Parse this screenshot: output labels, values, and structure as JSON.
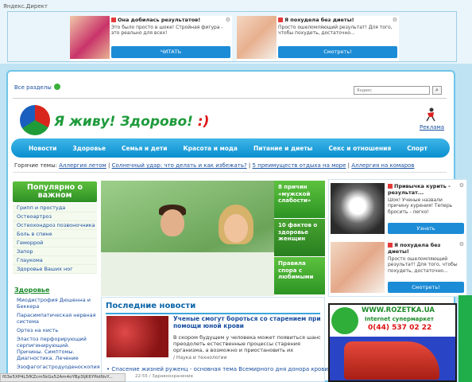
{
  "top_ad": {
    "label": "Яндекс.Директ",
    "ads": [
      {
        "title": "Она добилась результатов!",
        "text": "Это было просто в шоке! Стройная фигура - это реально для всех!",
        "button": "ЧИТАТЬ",
        "options_icon": "gear-icon"
      },
      {
        "title": "Я похудела без диеты!",
        "text": "Просто ошеломляющий результат! Для того, чтобы похудеть, достаточно...",
        "button": "Смотреть!",
        "options_icon": "gear-icon"
      }
    ]
  },
  "breadcrumb": {
    "all_sections": "Все разделы"
  },
  "search": {
    "placeholder": "Яндекс"
  },
  "logo": {
    "text": "Я живу! Здорово!",
    "smile": ":)"
  },
  "advertising_link": "Реклама",
  "menu": [
    "Новости",
    "Здоровье",
    "Семья и дети",
    "Красота и мода",
    "Питание и диеты",
    "Секс и отношения",
    "Спорт"
  ],
  "hot_topics": {
    "label": "Горячие темы:",
    "links": [
      "Аллергия летом",
      "Солнечный удар: что делать и как избежать?",
      "5 преимуществ отдыха на море",
      "Аллергия на комаров"
    ]
  },
  "popular": {
    "title": "Популярно о важном",
    "items": [
      "Грипп и простуда",
      "Остеоартроз",
      "Остеохондроз позвоночника",
      "Боль в спине",
      "Геморрой",
      "Запор",
      "Глаукома",
      "Здоровье Ваших ног"
    ]
  },
  "health": {
    "title": "Здоровье",
    "items": [
      "Миодистрофия Дюшенна и Беккера",
      "Парасимпатическая нервная система",
      "Ортез на кисть",
      "Эластоз перфорирующий серпигинирующий. Причины. Симптомы. Диагностика. Лечение",
      "Эзофагогастродуоденоскопия"
    ]
  },
  "hero_tiles": [
    "8 причин «мужской слабости»",
    "10 фактов о здоровье женщин",
    "Правила спора с любимыми"
  ],
  "news": {
    "title": "Последние новости",
    "items": [
      {
        "title": "Ученые смогут бороться со старением при помощи юной крови",
        "text": "В скором будущем у человека может появиться шанс преодолеть естественные процессы старения организма, а возможно и приостановить их",
        "category": "/ Наука и технологии"
      },
      {
        "title": "Спасение жизней руженц - основная тема Всемирного дня донора крови",
        "meta": "22:55 / Здравоохранение"
      }
    ]
  },
  "side_ads": [
    {
      "title": "Привычка курить - результат...",
      "text": "Шок! Ученые назвали причину курения! Теперь бросить - легко!",
      "button": "Узнать"
    },
    {
      "title": "Я похудела без диеты!",
      "text": "Просто ошеломляющий результат! Для того, чтобы похудеть, достаточно...",
      "button": "Смотреть!"
    }
  ],
  "rozetka": {
    "name": "WWW.ROZETKA.UA",
    "subtitle": "Internet супермаркет",
    "phone": "0(44) 537 02 22"
  },
  "status_bar": "f03e5XP4L5fKZcm5kGs52Am4oYBp3IjK6YPotNvY..."
}
